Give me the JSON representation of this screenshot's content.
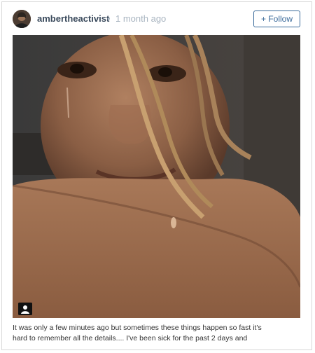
{
  "header": {
    "username": "ambertheactivist",
    "separator": "•",
    "time_ago": "1 month ago",
    "follow_label": "+ Follow"
  },
  "icons": {
    "avatar": "profile-photo",
    "media": "camera-profile-icon"
  },
  "caption": {
    "line1": "It was only a few minutes ago but sometimes these things happen so fast it's",
    "line2": "hard to remember all the details.... I've been sick for the past 2 days and"
  },
  "colors": {
    "username": "#3a4a5c",
    "meta": "#a8b4c0",
    "follow": "#3a6a9a"
  }
}
